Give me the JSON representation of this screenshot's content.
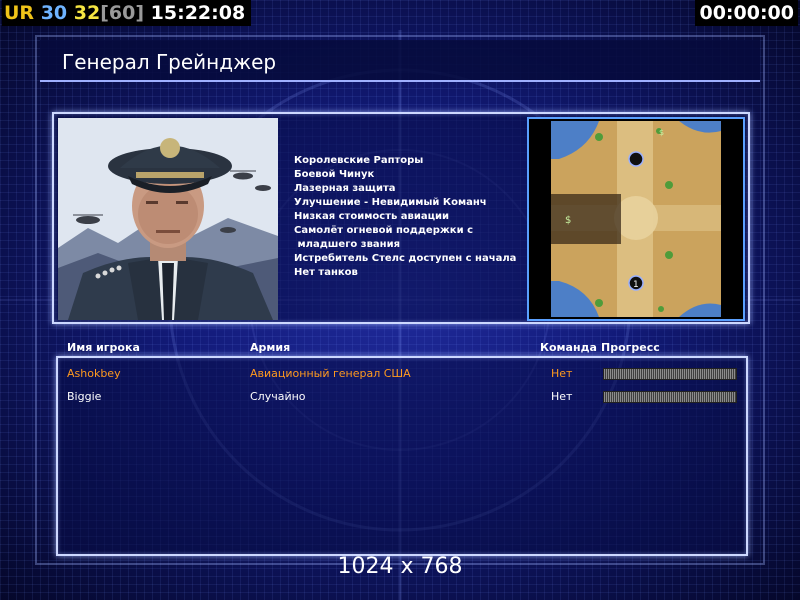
{
  "hud": {
    "tag": "UR",
    "fps_a": "30",
    "fps_b": "32",
    "fps_cap": "[60]",
    "clock": "15:22:08",
    "timer": "00:00:00"
  },
  "general": {
    "title": "Генерал Грейнджер",
    "features": [
      "Королевские Рапторы",
      "Боевой Чинук",
      "Лазерная защита",
      "Улучшение - Невидимый Команч",
      "Низкая стоимость авиации",
      "Самолёт огневой поддержки с",
      " младшего звания",
      "Истребитель Стелс доступен с начала",
      "Нет танков"
    ]
  },
  "minimap": {
    "marker_labels": [
      "1"
    ]
  },
  "players_table": {
    "headers": {
      "name": "Имя игрока",
      "army": "Армия",
      "team": "Команда",
      "progress": "Прогресс"
    },
    "rows": [
      {
        "name": "Ashokbey",
        "army": "Авиационный генерал США",
        "team": "Нет",
        "progress": 1.0,
        "color": "#ff9a1f"
      },
      {
        "name": "Biggie",
        "army": "Случайно",
        "team": "Нет",
        "progress": 1.0,
        "color": "#ffffff"
      }
    ]
  },
  "resolution": "1024 x 768",
  "colors": {
    "frame": "#cdd8ff",
    "highlight_player": "#ff9a1f"
  }
}
